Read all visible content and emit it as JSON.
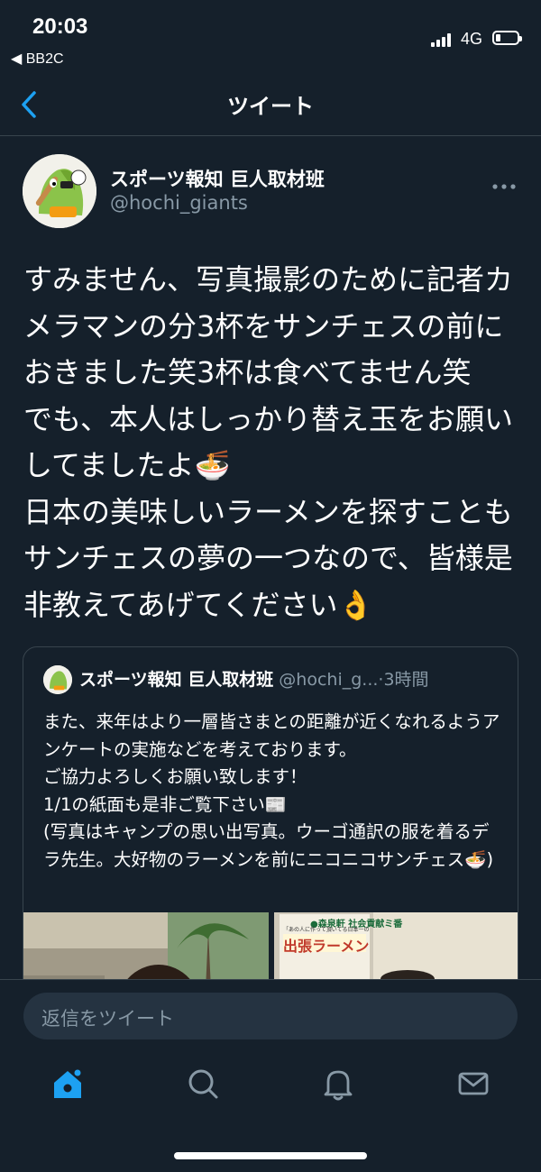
{
  "status_bar": {
    "time": "20:03",
    "back_app": "◀ BB2C",
    "network": "4G"
  },
  "nav": {
    "title": "ツイート",
    "back_icon": "chevron-left-icon"
  },
  "tweet": {
    "author_name": "スポーツ報知 巨人取材班",
    "author_handle": "@hochi_giants",
    "more_icon": "more-horizontal-icon",
    "text": "すみません、写真撮影のために記者カメラマンの分3杯をサンチェスの前におきました笑3杯は食べてません笑\nでも、本人はしっかり替え玉をお願いしてましたよ🍜\n日本の美味しいラーメンを探すこともサンチェスの夢の一つなので、皆様是非教えてあげてください👌"
  },
  "quote": {
    "author_name": "スポーツ報知 巨人取材班",
    "author_handle": "@hochi_g...",
    "time": "3時間",
    "text": "また、来年はより一層皆さまとの距離が近くなれるようアンケートの実施などを考えております。\nご協力よろしくお願い致します！\n1/1の紙面も是非ご覧下さい📰\n(写真はキャンプの思い出写真。ウーゴ通訳の服を着るデラ先生。大好物のラーメンを前にニコニコサンチェス🍜)",
    "photo2_text": {
      "line1": "●森泉軒  社会貢献ミ番",
      "line2": "「あの人に作って頂いてる日本一のラーメンプロジェクト",
      "title": "出張ラーメン"
    }
  },
  "reply": {
    "placeholder": "返信をツイート"
  },
  "tabs": {
    "home_icon": "home-icon",
    "search_icon": "search-icon",
    "notifications_icon": "bell-icon",
    "messages_icon": "mail-icon"
  },
  "colors": {
    "background": "#15202b",
    "accent": "#1da1f2",
    "secondary_text": "#8899a6",
    "divider": "#38444d"
  }
}
